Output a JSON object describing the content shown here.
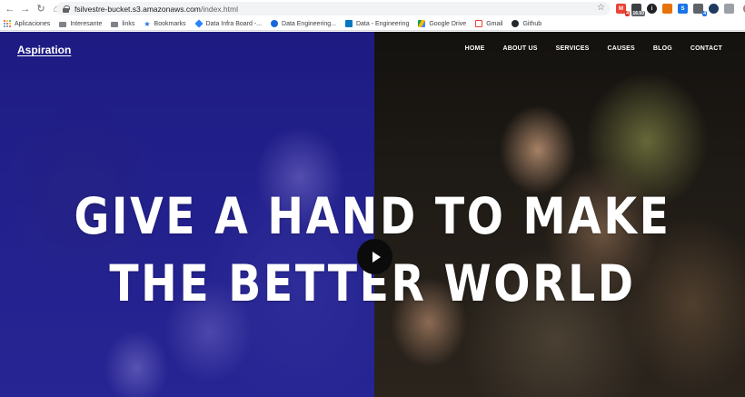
{
  "browser": {
    "url_host": "fsilvestre-bucket.s3.amazonaws.com",
    "url_path": "/index.html",
    "extensions": [
      {
        "name": "gmail-ext-icon",
        "color": "#ea4335",
        "badge": "4"
      },
      {
        "name": "ext-icon-2",
        "color": "#3c4043",
        "badge": "16.50"
      },
      {
        "name": "ext-icon-3",
        "color": "#202124",
        "badge": ""
      },
      {
        "name": "ext-icon-4",
        "color": "#e8710a",
        "badge": ""
      },
      {
        "name": "ext-icon-5",
        "color": "#1a73e8",
        "badge": ""
      },
      {
        "name": "ext-icon-6",
        "color": "#5f6368",
        "badge": "4"
      },
      {
        "name": "ext-icon-7",
        "color": "#1e3a5f",
        "badge": ""
      },
      {
        "name": "ext-icon-8",
        "color": "#9aa0a6",
        "badge": ""
      }
    ]
  },
  "bookmarks": [
    {
      "label": "Aplicaciones",
      "icon": "apps-grid-icon"
    },
    {
      "label": "Interesante",
      "icon": "folder-icon"
    },
    {
      "label": "links",
      "icon": "folder-icon"
    },
    {
      "label": "Bookmarks",
      "icon": "star-icon"
    },
    {
      "label": "Data Infra Board -...",
      "icon": "jira-icon"
    },
    {
      "label": "Data Engineering...",
      "icon": "confluence-icon"
    },
    {
      "label": "Data - Engineering",
      "icon": "trello-icon"
    },
    {
      "label": "Google Drive",
      "icon": "drive-icon"
    },
    {
      "label": "Gmail",
      "icon": "gmail-icon"
    },
    {
      "label": "Github",
      "icon": "github-icon"
    }
  ],
  "site": {
    "brand": "Aspiration",
    "nav": [
      "HOME",
      "ABOUT US",
      "SERVICES",
      "CAUSES",
      "BLOG",
      "CONTACT"
    ],
    "headline_line1": "GIVE A HAND TO MAKE",
    "headline_line2": "THE BETTER WORLD"
  },
  "colors": {
    "hero_overlay": "#2320aa",
    "play_button": "#0b0b0b",
    "text": "#ffffff"
  }
}
